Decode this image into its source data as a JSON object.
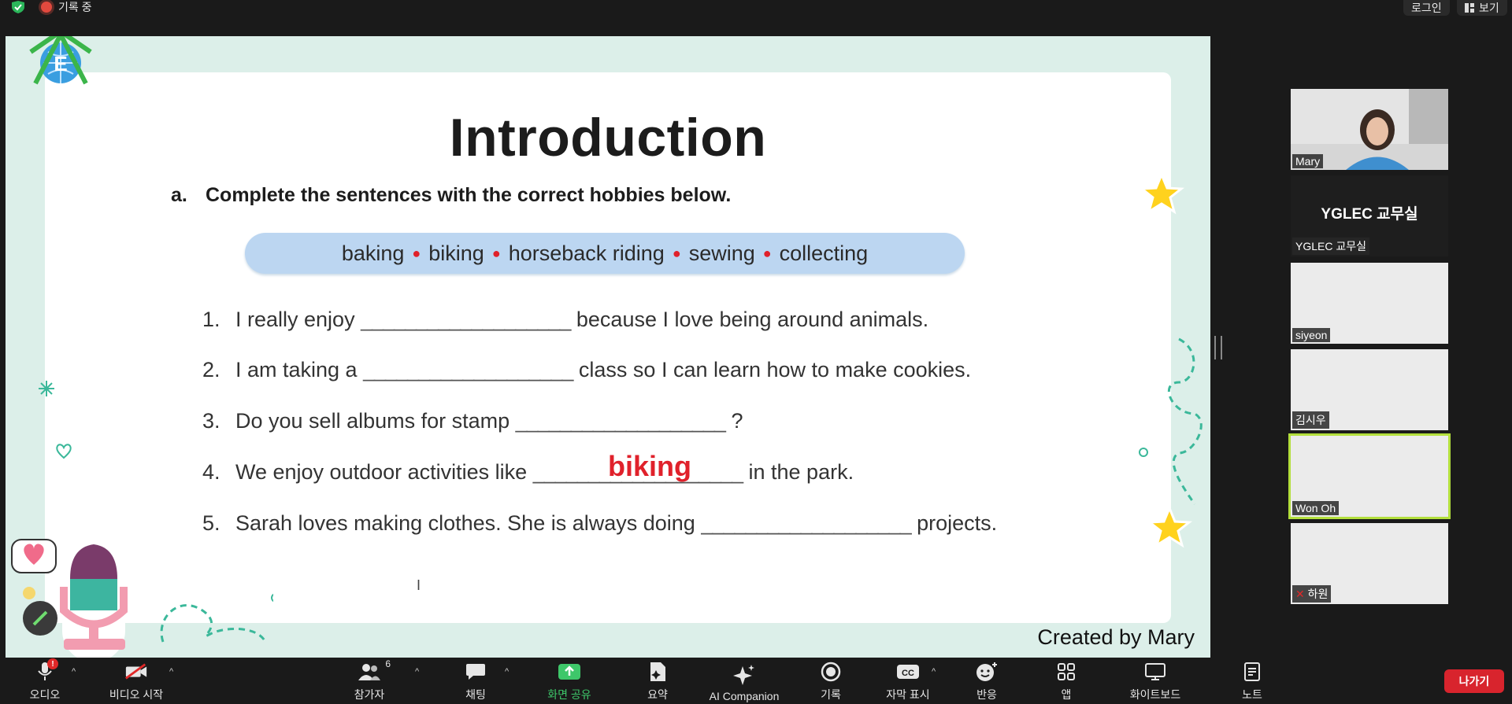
{
  "topbar": {
    "recording_label": "기록 중",
    "login_label": "로그인",
    "view_label": "보기"
  },
  "slide": {
    "title": "Introduction",
    "instruction_letter": "a.",
    "instruction": "Complete the sentences with the correct hobbies below.",
    "word_bank": [
      "baking",
      "biking",
      "horseback riding",
      "sewing",
      "collecting"
    ],
    "questions": [
      {
        "num": "1.",
        "before": "I really enjoy ",
        "blank": "___________________",
        "after": "  because I love being around animals."
      },
      {
        "num": "2.",
        "before": "I am taking a ",
        "blank": "___________________",
        "after": " class so I can learn how to make cookies."
      },
      {
        "num": "3.",
        "before": "Do you sell albums for stamp ",
        "blank": "___________________",
        "after": " ?"
      },
      {
        "num": "4.",
        "before": "We enjoy outdoor activities like ",
        "blank": "___________________",
        "after": " in the park."
      },
      {
        "num": "5.",
        "before": "Sarah loves making clothes. She is always doing ",
        "blank": "___________________",
        "after": " projects."
      }
    ],
    "filled_answer": "biking",
    "credit": "Created by Mary"
  },
  "gallery": {
    "participants": [
      {
        "name": "Mary"
      },
      {
        "name": "YGLEC 교무실",
        "title": "YGLEC 교무실"
      },
      {
        "name": "siyeon"
      },
      {
        "name": "김시우"
      },
      {
        "name": "Won Oh"
      },
      {
        "name": "하원"
      }
    ]
  },
  "toolbar": {
    "audio": "오디오",
    "audio_badge": "!",
    "video": "비디오 시작",
    "participants": "참가자",
    "participants_count": "6",
    "chat": "채팅",
    "share": "화면 공유",
    "summary": "요약",
    "ai": "AI Companion",
    "record": "기록",
    "captions": "자막 표시",
    "cc": "CC",
    "reactions": "반응",
    "apps": "앱",
    "whiteboard": "화이트보드",
    "notes": "노트",
    "leave": "나가기"
  },
  "colors": {
    "accent_green": "#3ec76a",
    "leave_red": "#d8242d",
    "answer_red": "#e0212b",
    "active_speaker": "#b3df3c"
  }
}
